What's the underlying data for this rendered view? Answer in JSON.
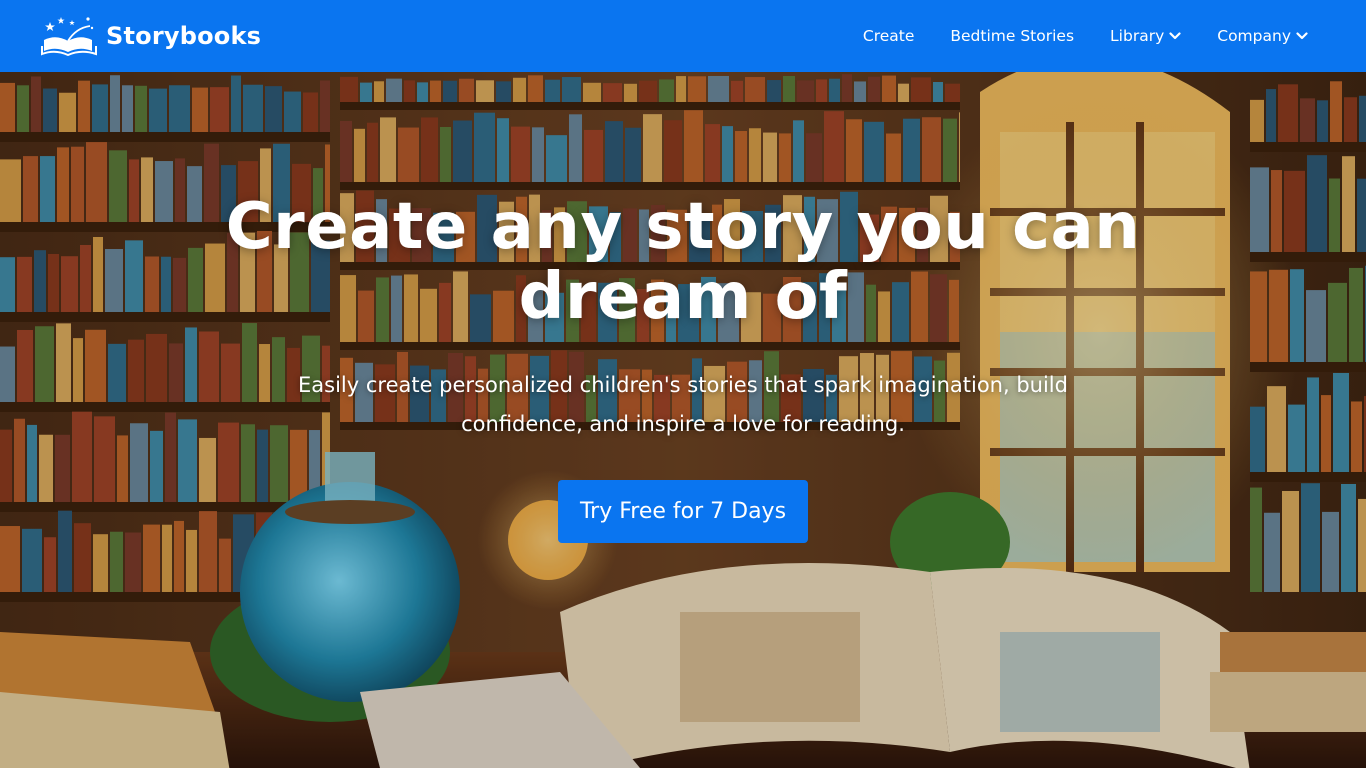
{
  "header": {
    "brand": "Storybooks",
    "nav": [
      {
        "label": "Create",
        "has_dropdown": false
      },
      {
        "label": "Bedtime Stories",
        "has_dropdown": false
      },
      {
        "label": "Library",
        "has_dropdown": true
      },
      {
        "label": "Company",
        "has_dropdown": true
      }
    ]
  },
  "hero": {
    "title": "Create any story you can dream of",
    "subtitle": "Easily create personalized children's stories that spark imagination, build confidence, and inspire a love for reading.",
    "cta_label": "Try Free for 7 Days"
  },
  "colors": {
    "brand_blue": "#0a75f0",
    "text_white": "#ffffff"
  },
  "icons": [
    "open-book-logo-icon",
    "chevron-down-icon"
  ]
}
